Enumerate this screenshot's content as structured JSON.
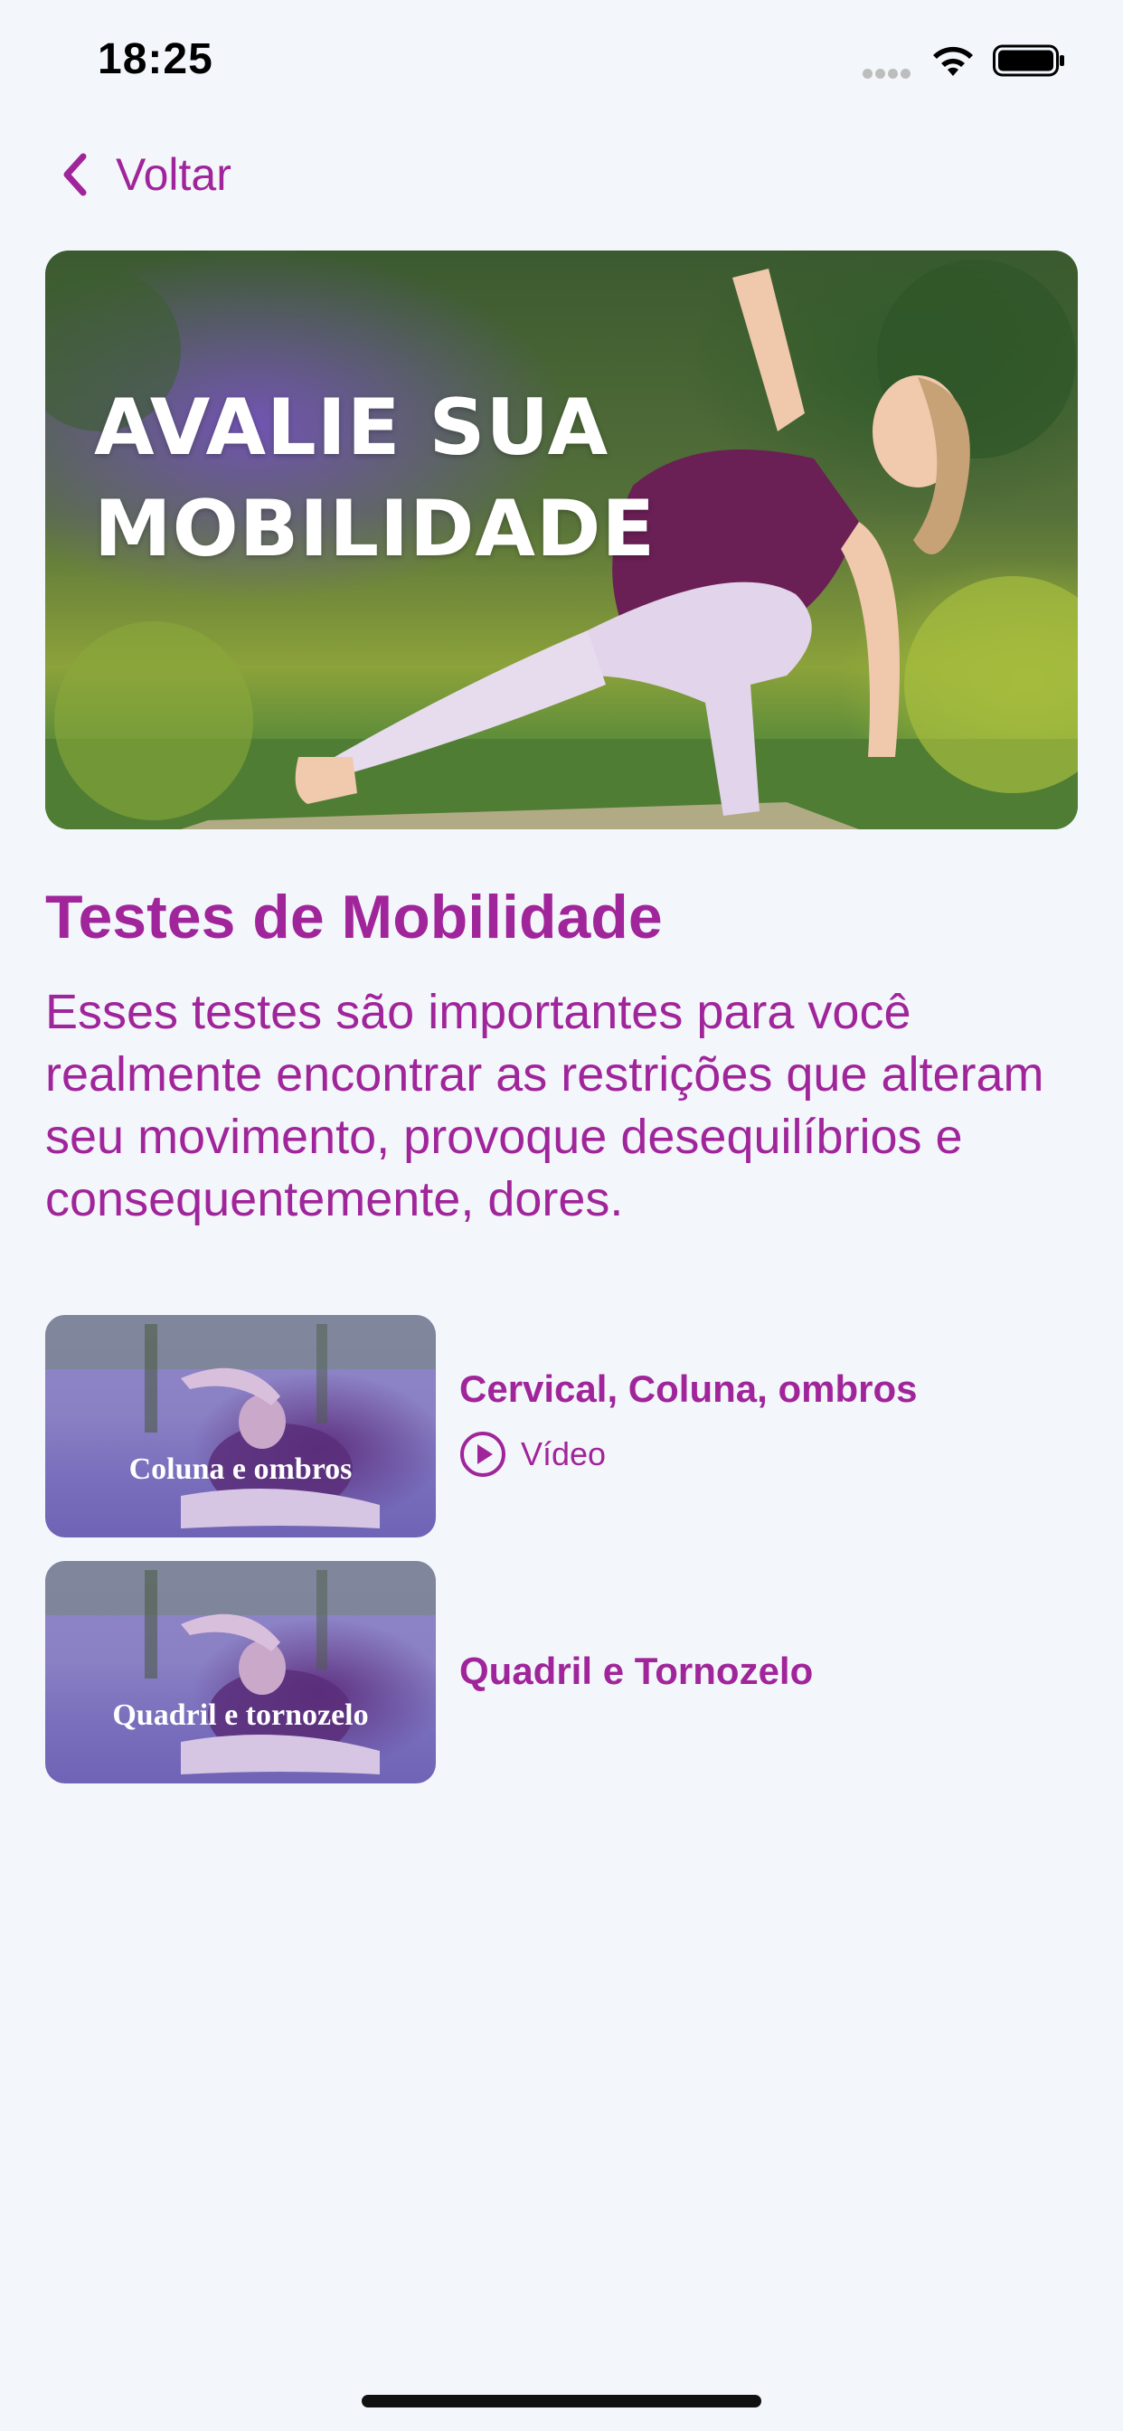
{
  "status_bar": {
    "time": "18:25"
  },
  "nav": {
    "back_label": "Voltar"
  },
  "hero": {
    "title_line1": "AVALIE SUA",
    "title_line2": "MOBILIDADE"
  },
  "page": {
    "title": "Testes de Mobilidade",
    "description": "Esses testes são importantes para você realmente encontrar as restrições que alteram seu movimento, provoque desequilíbrios e consequentemente, dores."
  },
  "tests": [
    {
      "thumb_label": "Coluna e ombros",
      "title": "Cervical, Coluna, ombros",
      "video_label": "Vídeo"
    },
    {
      "thumb_label": "Quadril e tornozelo",
      "title": "Quadril e Tornozelo"
    }
  ],
  "colors": {
    "accent": "#A1259A",
    "background": "#F3F7FC"
  },
  "icons": {
    "back": "chevron-left-icon",
    "video": "play-circle-icon",
    "wifi": "wifi-icon",
    "battery": "battery-icon"
  }
}
